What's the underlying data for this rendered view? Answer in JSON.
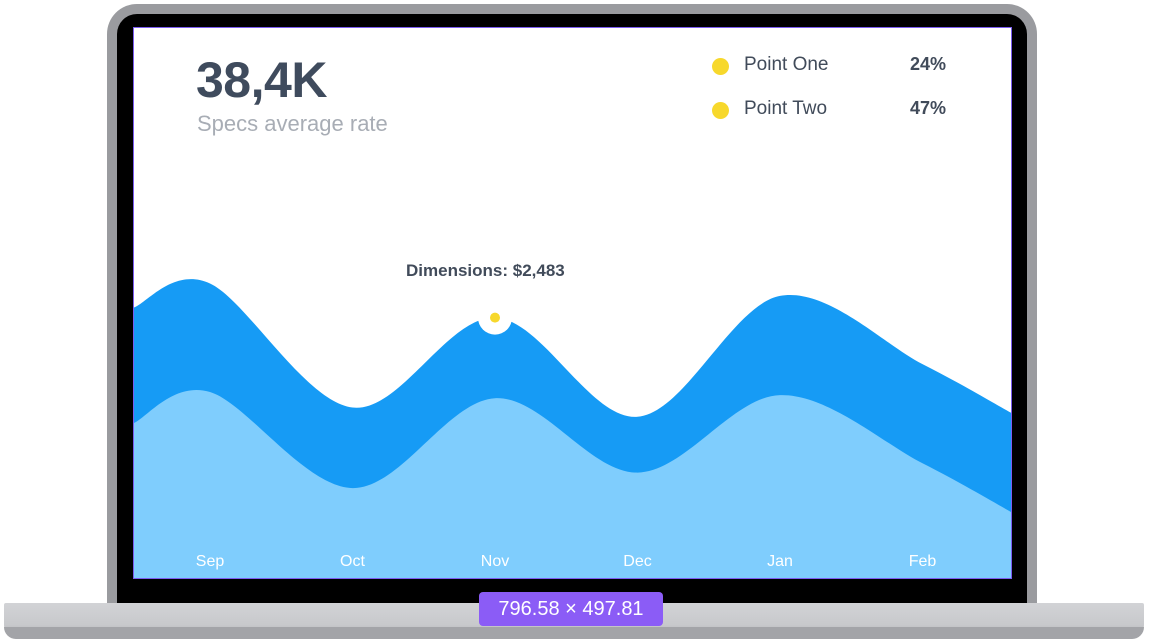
{
  "kpi": {
    "value": "38,4K",
    "label": "Specs average rate"
  },
  "legend": {
    "items": [
      {
        "label": "Point One",
        "value": "24%",
        "color": "#f7d82c"
      },
      {
        "label": "Point Two",
        "value": "47%",
        "color": "#f7d82c"
      }
    ]
  },
  "tooltip": {
    "text": "Dimensions: $2,483"
  },
  "colors": {
    "back_area": "#169bf5",
    "front_area": "#7fcdfd",
    "marker": "#f7d82c",
    "selection_border": "#7b5cf0",
    "dimension_badge": "#8b5cf6"
  },
  "chart_data": {
    "type": "area",
    "categories": [
      "Sep",
      "Oct",
      "Nov",
      "Dec",
      "Jan",
      "Feb"
    ],
    "series": [
      {
        "values": [
          95,
          55,
          84,
          52,
          91,
          69
        ]
      },
      {
        "values": [
          60,
          29,
          58,
          34,
          59,
          37
        ]
      }
    ],
    "ylim": [
      0,
      100
    ],
    "highlight": {
      "category": "Nov",
      "series": 0
    }
  },
  "dimension_badge": {
    "text": "796.58 × 497.81"
  }
}
